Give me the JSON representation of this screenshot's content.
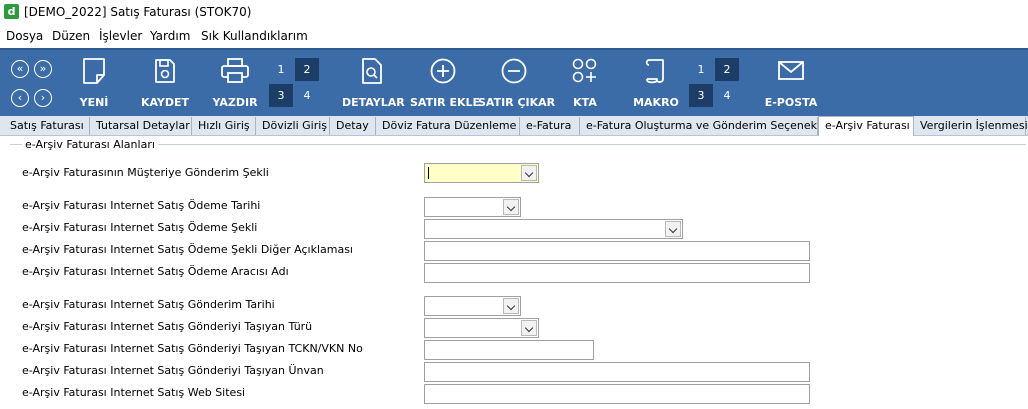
{
  "window": {
    "title": "[DEMO_2022] Satış Faturası (STOK70)",
    "app_icon_letter": "d"
  },
  "menu": [
    "Dosya",
    "Düzen",
    "İşlevler",
    "Yardım",
    "Sık Kullandıklarım"
  ],
  "toolbar": {
    "nav_buttons": [
      "«",
      "»",
      "‹",
      "›"
    ],
    "new_label": "YENİ",
    "save_label": "KAYDET",
    "print_label": "YAZDIR",
    "grid1": [
      "1",
      "2",
      "3",
      "4"
    ],
    "details_label": "DETAYLAR",
    "add_row_label": "SATIR EKLE",
    "remove_row_label": "SATIR ÇIKAR",
    "kta_label": "KTA",
    "macro_label": "MAKRO",
    "grid2": [
      "1",
      "2",
      "3",
      "4"
    ],
    "email_label": "E-POSTA"
  },
  "tabs": [
    "Satış Faturası",
    "Tutarsal Detaylar",
    "Hızlı Giriş",
    "Dövizli Giriş",
    "Detay",
    "Döviz Fatura Düzenleme",
    "e-Fatura",
    "e-Fatura Oluşturma ve Gönderim Seçenekleri",
    "e-Arşiv Faturası",
    "Vergilerin İşlenmesi"
  ],
  "active_tab": "e-Arşiv Faturası",
  "group": {
    "title": "e-Arşiv Faturası Alanları"
  },
  "fields": {
    "send_method": {
      "label": "e-Arşiv Faturasının Müşteriye Gönderim Şekli",
      "value": ""
    },
    "payment_date": {
      "label": "e-Arşiv Faturası Internet Satış Ödeme Tarihi",
      "value": ""
    },
    "payment_method": {
      "label": "e-Arşiv Faturası Internet Satış Ödeme Şekli",
      "value": ""
    },
    "payment_method_other": {
      "label": "e-Arşiv Faturası Internet Satış Ödeme Şekli Diğer Açıklaması",
      "value": ""
    },
    "payment_agent": {
      "label": "e-Arşiv Faturası Internet Satış Ödeme Aracısı Adı",
      "value": ""
    },
    "ship_date": {
      "label": "e-Arşiv Faturası Internet Satış Gönderim Tarihi",
      "value": ""
    },
    "carrier_type": {
      "label": "e-Arşiv Faturası Internet Satış Gönderiyi Taşıyan Türü",
      "value": ""
    },
    "carrier_id": {
      "label": "e-Arşiv Faturası Internet Satış Gönderiyi Taşıyan TCKN/VKN No",
      "value": ""
    },
    "carrier_title": {
      "label": "e-Arşiv Faturası Internet Satış Gönderiyi Taşıyan Ünvan",
      "value": ""
    },
    "website": {
      "label": "e-Arşiv Faturası Internet Satış Web Sitesi",
      "value": ""
    }
  }
}
